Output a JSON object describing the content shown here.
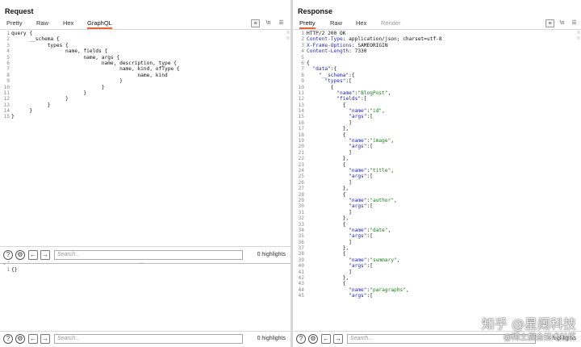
{
  "request": {
    "title": "Request",
    "tabs": [
      "Pretty",
      "Raw",
      "Hex",
      "GraphQL"
    ],
    "active_tab": "GraphQL",
    "query_lines": [
      "query {",
      "      __schema {",
      "            types {",
      "                  name, fields {",
      "                        name, args {",
      "                              name, description, type {",
      "                                    name, kind, ofType {",
      "                                          name, kind",
      "                                    }",
      "                              }",
      "                        }",
      "                  }",
      "            }",
      "      }",
      "}"
    ],
    "variables_lines": [
      "{}"
    ],
    "search_top": {
      "placeholder": "Search...",
      "highlights": "0 highlights"
    },
    "search_bottom": {
      "placeholder": "Search...",
      "highlights": "0 highlights"
    }
  },
  "response": {
    "title": "Response",
    "tabs": [
      "Pretty",
      "Raw",
      "Hex",
      "Render"
    ],
    "active_tab": "Pretty",
    "disabled_tab": "Render",
    "search": {
      "placeholder": "Search...",
      "highlights": "0 highlights"
    },
    "lines": [
      [
        [
          "p",
          "HTTP/2 200 OK"
        ]
      ],
      [
        [
          "h",
          "Content-Type"
        ],
        [
          "p",
          ": application/json; charset=utf-8"
        ]
      ],
      [
        [
          "h",
          "X-Frame-Options"
        ],
        [
          "p",
          ": SAMEORIGIN"
        ]
      ],
      [
        [
          "h",
          "Content-Length"
        ],
        [
          "p",
          ": 7330"
        ]
      ],
      [
        [
          "p",
          ""
        ]
      ],
      [
        [
          "p",
          "{"
        ]
      ],
      [
        [
          "p",
          "  "
        ],
        [
          "k",
          "\"data\""
        ],
        [
          "p",
          ":{"
        ]
      ],
      [
        [
          "p",
          "    "
        ],
        [
          "k",
          "\"__schema\""
        ],
        [
          "p",
          ":{"
        ]
      ],
      [
        [
          "p",
          "      "
        ],
        [
          "k",
          "\"types\""
        ],
        [
          "p",
          ":["
        ]
      ],
      [
        [
          "p",
          "        {"
        ]
      ],
      [
        [
          "p",
          "          "
        ],
        [
          "k",
          "\"name\""
        ],
        [
          "p",
          ":"
        ],
        [
          "s",
          "\"BlogPost\""
        ],
        [
          "p",
          ","
        ]
      ],
      [
        [
          "p",
          "          "
        ],
        [
          "k",
          "\"fields\""
        ],
        [
          "p",
          ":["
        ]
      ],
      [
        [
          "p",
          "            {"
        ]
      ],
      [
        [
          "p",
          "              "
        ],
        [
          "k",
          "\"name\""
        ],
        [
          "p",
          ":"
        ],
        [
          "s",
          "\"id\""
        ],
        [
          "p",
          ","
        ]
      ],
      [
        [
          "p",
          "              "
        ],
        [
          "k",
          "\"args\""
        ],
        [
          "p",
          ":["
        ]
      ],
      [
        [
          "p",
          "              ]"
        ]
      ],
      [
        [
          "p",
          "            },"
        ]
      ],
      [
        [
          "p",
          "            {"
        ]
      ],
      [
        [
          "p",
          "              "
        ],
        [
          "k",
          "\"name\""
        ],
        [
          "p",
          ":"
        ],
        [
          "s",
          "\"image\""
        ],
        [
          "p",
          ","
        ]
      ],
      [
        [
          "p",
          "              "
        ],
        [
          "k",
          "\"args\""
        ],
        [
          "p",
          ":["
        ]
      ],
      [
        [
          "p",
          "              ]"
        ]
      ],
      [
        [
          "p",
          "            },"
        ]
      ],
      [
        [
          "p",
          "            {"
        ]
      ],
      [
        [
          "p",
          "              "
        ],
        [
          "k",
          "\"name\""
        ],
        [
          "p",
          ":"
        ],
        [
          "s",
          "\"title\""
        ],
        [
          "p",
          ","
        ]
      ],
      [
        [
          "p",
          "              "
        ],
        [
          "k",
          "\"args\""
        ],
        [
          "p",
          ":["
        ]
      ],
      [
        [
          "p",
          "              ]"
        ]
      ],
      [
        [
          "p",
          "            },"
        ]
      ],
      [
        [
          "p",
          "            {"
        ]
      ],
      [
        [
          "p",
          "              "
        ],
        [
          "k",
          "\"name\""
        ],
        [
          "p",
          ":"
        ],
        [
          "s",
          "\"author\""
        ],
        [
          "p",
          ","
        ]
      ],
      [
        [
          "p",
          "              "
        ],
        [
          "k",
          "\"args\""
        ],
        [
          "p",
          ":["
        ]
      ],
      [
        [
          "p",
          "              ]"
        ]
      ],
      [
        [
          "p",
          "            },"
        ]
      ],
      [
        [
          "p",
          "            {"
        ]
      ],
      [
        [
          "p",
          "              "
        ],
        [
          "k",
          "\"name\""
        ],
        [
          "p",
          ":"
        ],
        [
          "s",
          "\"date\""
        ],
        [
          "p",
          ","
        ]
      ],
      [
        [
          "p",
          "              "
        ],
        [
          "k",
          "\"args\""
        ],
        [
          "p",
          ":["
        ]
      ],
      [
        [
          "p",
          "              ]"
        ]
      ],
      [
        [
          "p",
          "            },"
        ]
      ],
      [
        [
          "p",
          "            {"
        ]
      ],
      [
        [
          "p",
          "              "
        ],
        [
          "k",
          "\"name\""
        ],
        [
          "p",
          ":"
        ],
        [
          "s",
          "\"summary\""
        ],
        [
          "p",
          ","
        ]
      ],
      [
        [
          "p",
          "              "
        ],
        [
          "k",
          "\"args\""
        ],
        [
          "p",
          ":["
        ]
      ],
      [
        [
          "p",
          "              ]"
        ]
      ],
      [
        [
          "p",
          "            },"
        ]
      ],
      [
        [
          "p",
          "            {"
        ]
      ],
      [
        [
          "p",
          "              "
        ],
        [
          "k",
          "\"name\""
        ],
        [
          "p",
          ":"
        ],
        [
          "s",
          "\"paragraphs\""
        ],
        [
          "p",
          ","
        ]
      ],
      [
        [
          "p",
          "              "
        ],
        [
          "k",
          "\"args\""
        ],
        [
          "p",
          ":["
        ]
      ]
    ]
  },
  "watermark": {
    "line1": "知乎 @星阑科技",
    "line2": "@稀土掘金技术社区"
  },
  "colors": {
    "accent": "#e8663d",
    "json_key": "#1f1fa8",
    "json_string": "#1a7d1a",
    "header_key": "#2a2ab8"
  },
  "icons": {
    "help": "help-circle-icon",
    "settings": "gear-icon",
    "back": "arrow-left-icon",
    "forward": "arrow-right-icon",
    "layout_split": "layout-columns-icon",
    "layout_rows": "layout-rows-icon",
    "layout_single": "layout-single-icon",
    "wrap": "text-wrap-icon",
    "newline": "newline-icon",
    "menu": "menu-icon"
  }
}
